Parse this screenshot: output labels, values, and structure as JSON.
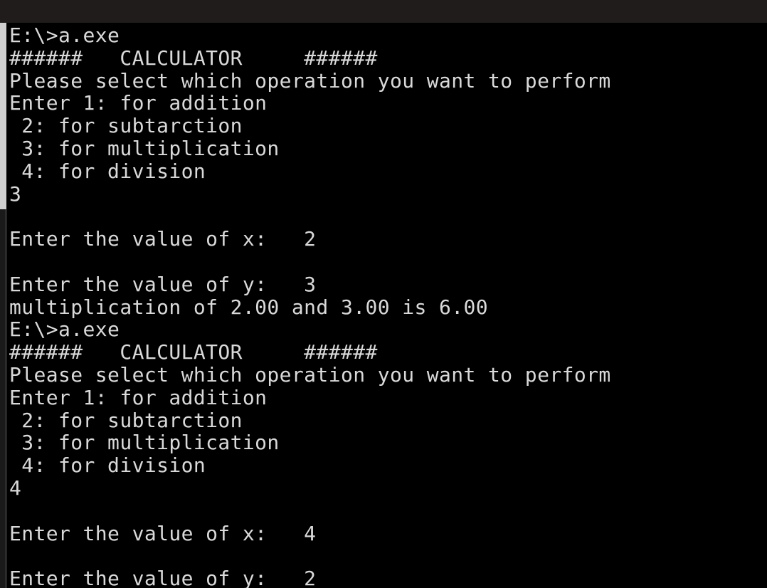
{
  "window": {
    "title_bar": "",
    "background": "#000000",
    "text_color": "#d9d9d9"
  },
  "console": {
    "lines": [
      "E:\\>a.exe",
      "######   CALCULATOR     ######",
      "Please select which operation you want to perform",
      "Enter 1: for addition",
      " 2: for subtarction",
      " 3: for multiplication",
      " 4: for division",
      "3",
      "",
      "Enter the value of x:   2",
      "",
      "Enter the value of y:   3",
      "multiplication of 2.00 and 3.00 is 6.00",
      "E:\\>a.exe",
      "######   CALCULATOR     ######",
      "Please select which operation you want to perform",
      "Enter 1: for addition",
      " 2: for subtarction",
      " 3: for multiplication",
      " 4: for division",
      "4",
      "",
      "Enter the value of x:   4",
      "",
      "Enter the value of y:   2"
    ]
  }
}
